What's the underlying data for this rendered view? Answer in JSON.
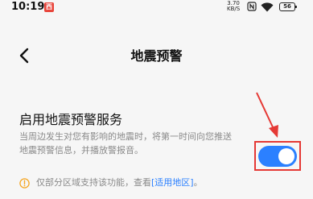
{
  "status_bar": {
    "time": "10:19",
    "app_badge": "西",
    "speed_value": "3.70",
    "speed_unit": "KB/S",
    "battery": "56"
  },
  "header": {
    "title": "地震预警"
  },
  "setting": {
    "title": "启用地震预警服务",
    "description": "当周边发生对您有影响的地震时，将第一时间向您推送地震预警信息，并播放警报音。",
    "enabled": true
  },
  "notice": {
    "text_prefix": "仅部分区域支持该功能，查看",
    "link_text": "[适用地区]",
    "text_suffix": "。"
  },
  "colors": {
    "accent": "#2b80ff",
    "highlight": "#e53935",
    "notice_icon": "#f5a623"
  }
}
